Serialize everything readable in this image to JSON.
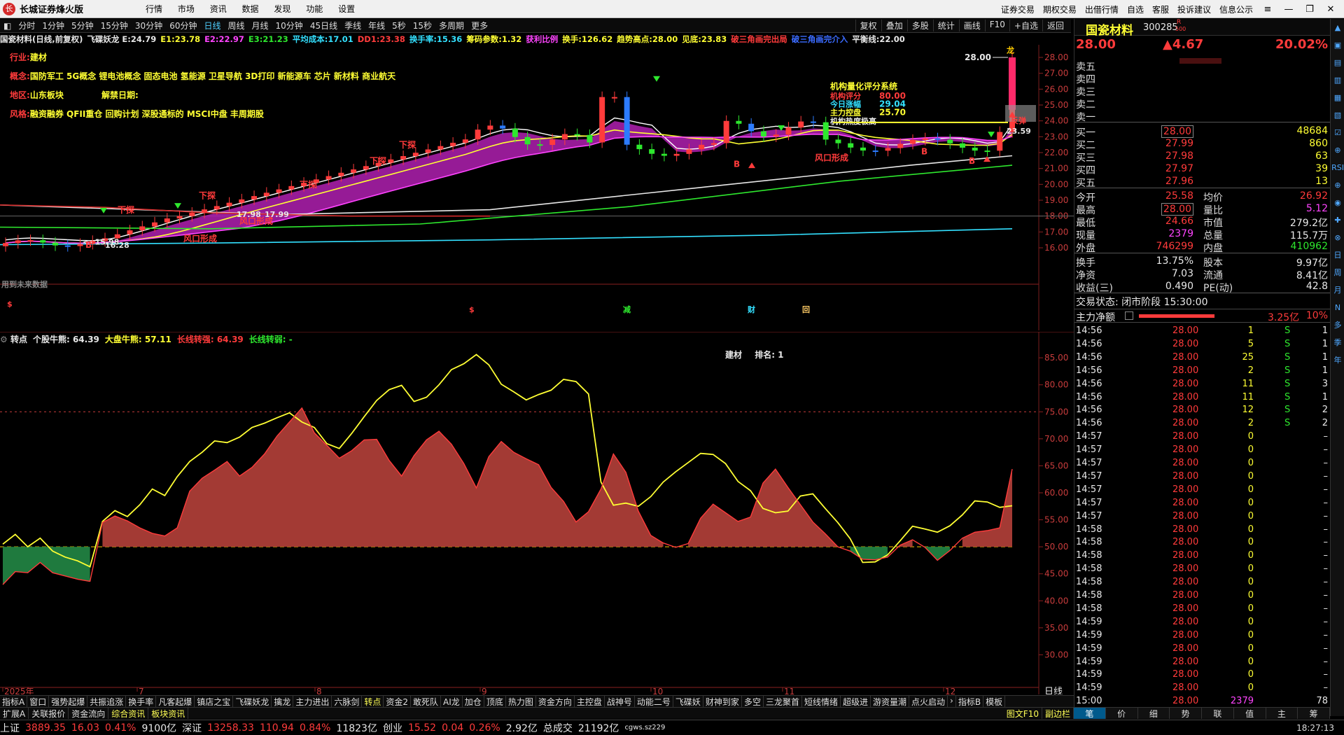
{
  "titlebar": {
    "app_title": "长城证券烽火版",
    "menu": [
      "行情",
      "市场",
      "资讯",
      "数据",
      "发现",
      "功能",
      "设置"
    ],
    "right_links": [
      "证券交易",
      "期权交易",
      "出借行情",
      "自选",
      "客服",
      "投诉建议",
      "信息公示"
    ]
  },
  "periods": {
    "items": [
      "分时",
      "1分钟",
      "5分钟",
      "15分钟",
      "30分钟",
      "60分钟",
      "日线",
      "周线",
      "月线",
      "10分钟",
      "45日线",
      "季线",
      "年线",
      "5秒",
      "15秒",
      "多周期",
      "更多"
    ],
    "active": "日线"
  },
  "tools": [
    "复权",
    "叠加",
    "多股",
    "统计",
    "画线",
    "F10",
    "+自选",
    "返回"
  ],
  "indicator_line": [
    {
      "text": "国瓷材料(日线,前复权)",
      "color": "#e8e8e8"
    },
    {
      "text": "飞碟妖龙 E:24.79",
      "color": "#e8e8e8"
    },
    {
      "text": "E1:23.78",
      "color": "#ffff33"
    },
    {
      "text": "E2:22.97",
      "color": "#ff44ff"
    },
    {
      "text": "E3:21.23",
      "color": "#2ee82e"
    },
    {
      "text": "平均成本:17.01",
      "color": "#33e0ff"
    },
    {
      "text": "DD1:23.38",
      "color": "#ff3b3b"
    },
    {
      "text": "换手率:15.36",
      "color": "#33e0ff"
    },
    {
      "text": "筹码参数:1.32",
      "color": "#ffff33"
    },
    {
      "text": "获利比例",
      "color": "#ff44ff"
    },
    {
      "text": "换手:126.62",
      "color": "#ffff33"
    },
    {
      "text": "趋势高点:28.00",
      "color": "#ffff33"
    },
    {
      "text": "见底:23.83",
      "color": "#ffff33"
    },
    {
      "text": "破三角画完出局",
      "color": "#ff3b3b"
    },
    {
      "text": "破三角画完介入",
      "color": "#3b6bff"
    },
    {
      "text": "平衡线:22.00",
      "color": "#e8e8e8"
    }
  ],
  "stock_info": {
    "industry_label": "行业:",
    "industry": "建材",
    "concept_label": "概念:",
    "concepts": "国防军工 5G概念 锂电池概念 固态电池 氢能源 卫星导航 3D打印 新能源车 芯片 新材料 商业航天",
    "region_label": "地区:",
    "region": "山东板块",
    "unlock_label": "解禁日期:",
    "style_label": "风格:",
    "style": "融资融券 QFII重仓 回购计划 深股通标的 MSCI中盘 丰周期股"
  },
  "main_chart": {
    "y_ticks": [
      "28.00",
      "27.00",
      "26.00",
      "25.00",
      "24.00",
      "23.00",
      "22.00",
      "21.00",
      "20.00",
      "19.00",
      "18.00",
      "17.00",
      "16.00"
    ],
    "price_labels": {
      "high": "28.00",
      "low": "15.98",
      "low2": "16.28",
      "mid": "17.98",
      "mid2": "17.99",
      "recent": "23.59"
    },
    "annotations": {
      "signal_down": "下探",
      "signal_wind": "风口形成",
      "signal_b": "B",
      "signal_dragon": "龙",
      "inst_title": "机构量化评分系统",
      "inst_score_label": "机构评分",
      "inst_score": "80.00",
      "inst_today_label": "今日涨幅",
      "inst_today": "29.04",
      "inst_main_label": "主力控盘",
      "inst_main": "25.70",
      "inst_block_label": "机构热度极高",
      "future_data": "用到未来数据",
      "marker_s": "$",
      "marker_reduce": "减",
      "marker_fin": "财",
      "marker_box": "回",
      "rebound": "反弹"
    }
  },
  "sub_chart": {
    "header": [
      {
        "text": "转点",
        "color": "#e8e8e8"
      },
      {
        "text": "个股牛熊: 64.39",
        "color": "#e8e8e8"
      },
      {
        "text": "大盘牛熊: 57.11",
        "color": "#ffff33"
      },
      {
        "text": "长线转强: 64.39",
        "color": "#ff3b3b"
      },
      {
        "text": "长线转弱: -",
        "color": "#2ee82e"
      }
    ],
    "sector_text": "建材",
    "rank_text": "排名: 1",
    "y_ticks": [
      "85.00",
      "80.00",
      "75.00",
      "70.00",
      "65.00",
      "60.00",
      "55.00",
      "50.00",
      "45.00",
      "40.00",
      "35.00",
      "30.00"
    ],
    "x_labels": [
      "2025年",
      "7",
      "8",
      "9",
      "10",
      "11",
      "12"
    ],
    "unit": "日线"
  },
  "chart_data": [
    {
      "type": "line",
      "title": "转点",
      "series": [
        {
          "name": "大盘牛熊",
          "color": "#ffff33",
          "values": [
            50.5,
            52.3,
            50.0,
            51.6,
            49.2,
            48.1,
            47.4,
            46.3,
            54.7,
            56.7,
            55.6,
            57.8,
            60.7,
            59.5,
            63.0,
            65.8,
            67.5,
            69.6,
            69.3,
            70.3,
            72.1,
            72.9,
            73.9,
            74.8,
            73.1,
            72.1,
            69.1,
            68.2,
            71.0,
            74.1,
            77.1,
            79.1,
            79.9,
            76.9,
            77.7,
            80.0,
            82.8,
            83.9,
            85.6,
            83.7,
            80.1,
            78.7,
            77.2,
            78.2,
            79.0,
            81.0,
            80.6,
            78.3,
            62.0,
            57.7,
            58.1,
            57.5,
            59.3,
            62.0,
            63.9,
            65.6,
            67.3,
            67.1,
            65.4,
            62.1,
            60.4,
            57.1,
            56.3,
            56.6,
            59.4,
            59.8,
            57.1,
            54.5,
            51.5,
            47.1,
            47.2,
            48.5,
            51.1,
            53.8,
            53.3,
            52.7,
            53.9,
            55.9,
            58.5,
            58.3,
            57.3,
            57.6
          ]
        },
        {
          "name": "个股牛熊",
          "color": "#ff3b3b",
          "values": [
            43.0,
            45.4,
            45.2,
            47.1,
            45.2,
            44.6,
            44.0,
            43.6,
            54.5,
            55.7,
            54.8,
            53.5,
            52.5,
            52.0,
            53.5,
            60.3,
            62.7,
            64.2,
            65.8,
            63.1,
            64.7,
            67.2,
            70.5,
            73.1,
            75.7,
            71.1,
            68.8,
            66.4,
            67.8,
            69.8,
            69.9,
            66.0,
            63.1,
            66.9,
            69.8,
            71.4,
            69.0,
            65.4,
            60.9,
            66.7,
            69.5,
            67.5,
            66.3,
            65.2,
            61.0,
            58.4,
            54.6,
            56.5,
            60.7,
            67.2,
            63.8,
            56.6,
            52.1,
            50.7,
            49.9,
            50.6,
            55.3,
            57.9,
            56.3,
            54.7,
            55.5,
            61.8,
            64.4,
            61.0,
            57.8,
            54.6,
            52.4,
            50.0,
            49.2,
            47.7,
            47.6,
            48.1,
            50.3,
            51.3,
            49.9,
            47.5,
            49.3,
            51.6,
            52.7,
            53.0,
            53.5,
            64.4
          ]
        }
      ],
      "ylim": [
        25,
        88
      ],
      "baseline": 50,
      "bull_line": 75
    }
  ],
  "right_panel": {
    "stock_name": "国瓷材料",
    "stock_code": "300285",
    "badge_r": "R",
    "badge_500": "500",
    "price": "28.00",
    "change": "▲4.67",
    "change_pct": "20.02%",
    "ask_labels": [
      "卖五",
      "卖四",
      "卖三",
      "卖二",
      "卖一"
    ],
    "bid": [
      {
        "label": "买一",
        "price": "28.00",
        "vol": "48684"
      },
      {
        "label": "买二",
        "price": "27.99",
        "vol": "860"
      },
      {
        "label": "买三",
        "price": "27.98",
        "vol": "63"
      },
      {
        "label": "买四",
        "price": "27.97",
        "vol": "39"
      },
      {
        "label": "买五",
        "price": "27.96",
        "vol": "13"
      }
    ],
    "stats": [
      {
        "l1": "今开",
        "v1": "25.58",
        "c1": "red",
        "l2": "均价",
        "v2": "26.92",
        "c2": "red"
      },
      {
        "l1": "最高",
        "v1": "28.00",
        "c1": "red",
        "l2": "量比",
        "v2": "5.12",
        "c2": "magenta"
      },
      {
        "l1": "最低",
        "v1": "24.66",
        "c1": "red",
        "l2": "市值",
        "v2": "279.2亿",
        "c2": "white"
      },
      {
        "l1": "现量",
        "v1": "2379",
        "c1": "magenta",
        "l2": "总量",
        "v2": "115.7万",
        "c2": "white"
      },
      {
        "l1": "外盘",
        "v1": "746299",
        "c1": "red",
        "l2": "内盘",
        "v2": "410962",
        "c2": "green"
      }
    ],
    "stats2": [
      {
        "l1": "换手",
        "v1": "13.75%",
        "l2": "股本",
        "v2": "9.97亿"
      },
      {
        "l1": "净资",
        "v1": "7.03",
        "l2": "流通",
        "v2": "8.41亿"
      },
      {
        "l1": "收益(三)",
        "v1": "0.490",
        "l2": "PE(动)",
        "v2": "42.8"
      }
    ],
    "trade_state": "交易状态: 闭市阶段 15:30:00",
    "main_net_label": "主力净额",
    "main_net_value": "3.25亿",
    "main_net_pct": "10%",
    "ticks": [
      {
        "t": "14:56",
        "p": "28.00",
        "v": "1",
        "s": "S",
        "n": "1"
      },
      {
        "t": "14:56",
        "p": "28.00",
        "v": "5",
        "s": "S",
        "n": "1"
      },
      {
        "t": "14:56",
        "p": "28.00",
        "v": "25",
        "s": "S",
        "n": "1"
      },
      {
        "t": "14:56",
        "p": "28.00",
        "v": "2",
        "s": "S",
        "n": "1"
      },
      {
        "t": "14:56",
        "p": "28.00",
        "v": "11",
        "s": "S",
        "n": "3"
      },
      {
        "t": "14:56",
        "p": "28.00",
        "v": "11",
        "s": "S",
        "n": "1"
      },
      {
        "t": "14:56",
        "p": "28.00",
        "v": "12",
        "s": "S",
        "n": "2"
      },
      {
        "t": "14:56",
        "p": "28.00",
        "v": "2",
        "s": "S",
        "n": "2"
      },
      {
        "t": "14:57",
        "p": "28.00",
        "v": "0",
        "s": "",
        "n": "–"
      },
      {
        "t": "14:57",
        "p": "28.00",
        "v": "0",
        "s": "",
        "n": "–"
      },
      {
        "t": "14:57",
        "p": "28.00",
        "v": "0",
        "s": "",
        "n": "–"
      },
      {
        "t": "14:57",
        "p": "28.00",
        "v": "0",
        "s": "",
        "n": "–"
      },
      {
        "t": "14:57",
        "p": "28.00",
        "v": "0",
        "s": "",
        "n": "–"
      },
      {
        "t": "14:57",
        "p": "28.00",
        "v": "0",
        "s": "",
        "n": "–"
      },
      {
        "t": "14:57",
        "p": "28.00",
        "v": "0",
        "s": "",
        "n": "–"
      },
      {
        "t": "14:58",
        "p": "28.00",
        "v": "0",
        "s": "",
        "n": "–"
      },
      {
        "t": "14:58",
        "p": "28.00",
        "v": "0",
        "s": "",
        "n": "–"
      },
      {
        "t": "14:58",
        "p": "28.00",
        "v": "0",
        "s": "",
        "n": "–"
      },
      {
        "t": "14:58",
        "p": "28.00",
        "v": "0",
        "s": "",
        "n": "–"
      },
      {
        "t": "14:58",
        "p": "28.00",
        "v": "0",
        "s": "",
        "n": "–"
      },
      {
        "t": "14:58",
        "p": "28.00",
        "v": "0",
        "s": "",
        "n": "–"
      },
      {
        "t": "14:58",
        "p": "28.00",
        "v": "0",
        "s": "",
        "n": "–"
      },
      {
        "t": "14:59",
        "p": "28.00",
        "v": "0",
        "s": "",
        "n": "–"
      },
      {
        "t": "14:59",
        "p": "28.00",
        "v": "0",
        "s": "",
        "n": "–"
      },
      {
        "t": "14:59",
        "p": "28.00",
        "v": "0",
        "s": "",
        "n": "–"
      },
      {
        "t": "14:59",
        "p": "28.00",
        "v": "0",
        "s": "",
        "n": "–"
      },
      {
        "t": "14:59",
        "p": "28.00",
        "v": "0",
        "s": "",
        "n": "–"
      },
      {
        "t": "14:59",
        "p": "28.00",
        "v": "0",
        "s": "",
        "n": "–"
      },
      {
        "t": "15:00",
        "p": "28.00",
        "v": "2379",
        "s": "",
        "n": "78"
      }
    ],
    "bottom_tabs": [
      "笔",
      "价",
      "细",
      "势",
      "联",
      "值",
      "主",
      "筹"
    ]
  },
  "edge_strip": [
    "▲",
    "▣",
    "▤",
    "▥",
    "▦",
    "▧",
    "☑",
    "⊕",
    "RSI",
    "⊕",
    "◉",
    "✚",
    "⊗",
    "日",
    "周",
    "月",
    "N",
    "多",
    "季",
    "年"
  ],
  "bottom_tabs": {
    "row1": [
      "指标A",
      "窗口",
      "强势起爆",
      "共振追涨",
      "换手率",
      "凡客起爆",
      "镇店之宝",
      "飞碟妖龙",
      "擒龙",
      "主力进出",
      "六脉剑",
      "转点",
      "资金2",
      "敢死队",
      "AI龙",
      "加仓",
      "顶底",
      "热力图",
      "资金方向",
      "主控盘",
      "战神号",
      "动能二号",
      "飞碟妖",
      "财神到家",
      "多空",
      "三龙聚首",
      "短线情绪",
      "超级进",
      "游资量潮",
      "点火启动",
      "›",
      "指标B",
      "模板"
    ],
    "row1_active": "转点",
    "row2": [
      "扩展A",
      "关联报价",
      "资金流向",
      "综合资讯",
      "板块资讯"
    ],
    "row2_alt": [
      "综合资讯",
      "板块资讯"
    ],
    "row2_right": [
      "图文F10",
      "副边栏"
    ]
  },
  "statusbar": {
    "sh_label": "上证",
    "sh_value": "3889.35",
    "sh_change": "16.03",
    "sh_pct": "0.41%",
    "sh_amount": "9100亿",
    "sz_label": "深证",
    "sz_value": "13258.33",
    "sz_change": "110.94",
    "sz_pct": "0.84%",
    "sz_amount": "11823亿",
    "cy_label": "创业",
    "cy_value": "15.52",
    "cy_change": "0.04",
    "cy_pct": "0.26%",
    "cy_amount": "2.92亿",
    "total_label": "总成交",
    "total_value": "21192亿",
    "server": "cgws.sz229",
    "clock": "18:27:13"
  },
  "colors": {
    "up": "#ff3b3b",
    "down": "#2ee82e",
    "bg": "#000000",
    "accent": "#4fd0ff",
    "fill_bull": "#a33a34",
    "fill_bear": "#1f7a3e",
    "magenta_fill": "#b020b0"
  }
}
